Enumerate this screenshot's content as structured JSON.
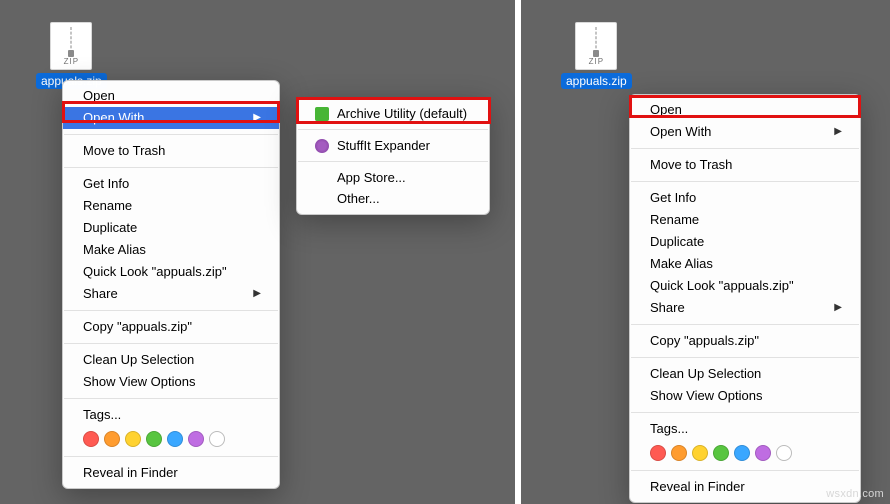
{
  "left": {
    "file_name": "appuals.zip",
    "menu": {
      "open": "Open",
      "open_with": "Open With",
      "move_to_trash": "Move to Trash",
      "get_info": "Get Info",
      "rename": "Rename",
      "duplicate": "Duplicate",
      "make_alias": "Make Alias",
      "quick_look": "Quick Look \"appuals.zip\"",
      "share": "Share",
      "copy": "Copy \"appuals.zip\"",
      "clean_up": "Clean Up Selection",
      "view_options": "Show View Options",
      "tags": "Tags...",
      "reveal": "Reveal in Finder"
    },
    "submenu": {
      "archive_utility": "Archive Utility (default)",
      "stuffit": "StuffIt Expander",
      "app_store": "App Store...",
      "other": "Other..."
    }
  },
  "right": {
    "file_name": "appuals.zip",
    "menu": {
      "open": "Open",
      "open_with": "Open With",
      "move_to_trash": "Move to Trash",
      "get_info": "Get Info",
      "rename": "Rename",
      "duplicate": "Duplicate",
      "make_alias": "Make Alias",
      "quick_look": "Quick Look \"appuals.zip\"",
      "share": "Share",
      "copy": "Copy \"appuals.zip\"",
      "clean_up": "Clean Up Selection",
      "view_options": "Show View Options",
      "tags": "Tags...",
      "reveal": "Reveal in Finder"
    }
  },
  "tag_colors": [
    "#ff5a52",
    "#ff9c2f",
    "#ffd230",
    "#58c540",
    "#3aa7ff",
    "#bf6de2"
  ],
  "watermark": "wsxdn.com"
}
